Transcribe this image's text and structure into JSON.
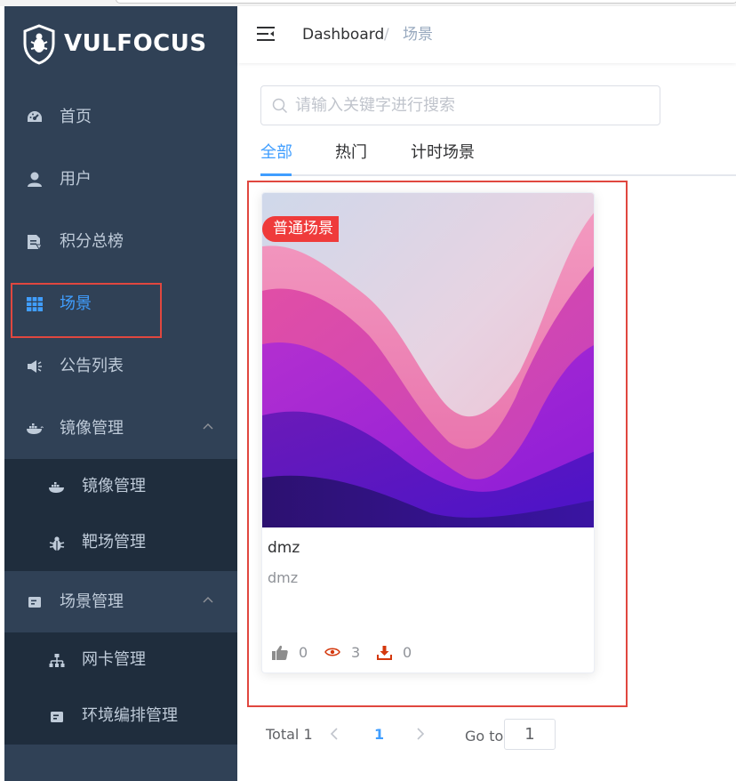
{
  "app": {
    "brand": "VULFOCUS"
  },
  "sidebar": {
    "items": [
      {
        "label": "首页",
        "icon": "dashboard-icon"
      },
      {
        "label": "用户",
        "icon": "user-icon"
      },
      {
        "label": "积分总榜",
        "icon": "ranking-document-icon"
      },
      {
        "label": "场景",
        "icon": "grid-table-icon",
        "active": true
      },
      {
        "label": "公告列表",
        "icon": "megaphone-icon"
      },
      {
        "label": "镜像管理",
        "icon": "docker-whale-icon",
        "expanded": true
      },
      {
        "label": "场景管理",
        "icon": "card-icon",
        "expanded": true
      }
    ],
    "image_submenu": [
      {
        "label": "镜像管理",
        "icon": "docker-whale-icon"
      },
      {
        "label": "靶场管理",
        "icon": "bug-icon"
      }
    ],
    "scene_submenu": [
      {
        "label": "网卡管理",
        "icon": "network-tree-icon"
      },
      {
        "label": "环境编排管理",
        "icon": "card-icon"
      }
    ]
  },
  "header": {
    "breadcrumb": [
      "Dashboard",
      "场景"
    ],
    "separator": "/"
  },
  "search": {
    "placeholder": "请输入关键字进行搜索",
    "value": ""
  },
  "tabs": [
    {
      "label": "全部",
      "active": true
    },
    {
      "label": "热门",
      "active": false
    },
    {
      "label": "计时场景",
      "active": false
    }
  ],
  "cards": [
    {
      "badge": "普通场景",
      "title": "dmz",
      "description": "dmz",
      "likes": "0",
      "views": "3",
      "downloads": "0"
    }
  ],
  "pagination": {
    "total_text": "Total 1",
    "current_page": "1",
    "goto_label": "Go to",
    "goto_value": "1"
  },
  "colors": {
    "sidebar_bg": "#304156",
    "submenu_bg": "#1f2d3d",
    "accent": "#409eff",
    "highlight_border": "#e0473f",
    "badge_bg": "#ef3b3b"
  }
}
